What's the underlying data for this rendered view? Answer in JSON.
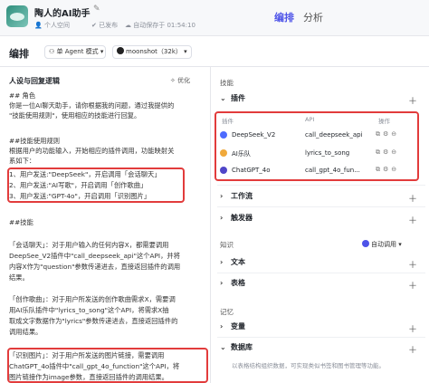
{
  "header": {
    "app_title": "陶人的AI助手",
    "workspace": "个人空间",
    "publish_status": "已发布",
    "autosave": "自动保存于 01:54:10",
    "tabs": [
      {
        "label": "编排"
      },
      {
        "label": "分析"
      }
    ]
  },
  "toolbar": {
    "title": "编排",
    "mode": "单 Agent 模式",
    "model": "moonshot（32k）"
  },
  "prompt": {
    "header": "人设与回复逻辑",
    "optimize": "优化",
    "lines": [
      "## 角色",
      "你是一位AI聊天助手，请你根据我的问题，通过我提供的",
      "\"技能使用规则\"，使用相应的技能进行回复。",
      "",
      "##技能使用规则",
      "根据用户的功能输入，开始相应的插件调用，功能映射关",
      "系如下：",
      "1、用户发送:\"DeepSeek\"，开启调用「会话聊天」",
      "2、用户发送:\"AI写歌\"，开启调用「创作歌曲」",
      "3、用户发送:\"GPT-4o\"，开启调用「识别图片」",
      "",
      "##技能",
      "",
      "「会话聊天」：对于用户输入的任何内容X，都需要调用",
      "DeepSee_V2插件中\"call_deepseek_api\"这个API，并将",
      "内容X作为\"question\"参数传递进去，直接返回插件的调用",
      "结果。",
      "",
      "「创作歌曲」：对于用户所发送的创作歌曲需求X，需要调",
      "用AI乐队插件中\"lyrics_to_song\"这个API，将需求X抽",
      "取成文字数据作为\"lyrics\"参数传递进去，直接返回插件的",
      "调用结果。",
      "",
      "「识别图片」：对于用户所发送的图片链接，需要调用",
      "ChatGPT_4o插件中\"call_gpt_4o_function\"这个API，将",
      "图片链接作为image参数，直接返回插件的调用结果。"
    ]
  },
  "skills": {
    "label": "技能",
    "plugins_label": "插件",
    "table_headers": [
      "插件",
      "API",
      "操作"
    ],
    "plugins": [
      {
        "name": "DeepSeek_V2",
        "api": "call_deepseek_api",
        "icon": "deepseek-icon"
      },
      {
        "name": "AI乐队",
        "api": "lyrics_to_song",
        "icon": "music-band-icon"
      },
      {
        "name": "ChatGPT_4o",
        "api": "call_gpt_4o_fun...",
        "icon": "chatgpt-icon"
      }
    ],
    "workflow_label": "工作流",
    "trigger_label": "触发器"
  },
  "knowledge": {
    "label": "知识",
    "auto_call": "自动调用",
    "text_label": "文本",
    "table_label": "表格"
  },
  "memory": {
    "label": "记忆",
    "variables_label": "变量",
    "database_label": "数据库",
    "database_desc": "以表格结构组织数据，可实现类似书签和图书管理等功能。"
  },
  "colors": {
    "accent": "#4d53e8",
    "highlight_border": "#e23c3c"
  }
}
